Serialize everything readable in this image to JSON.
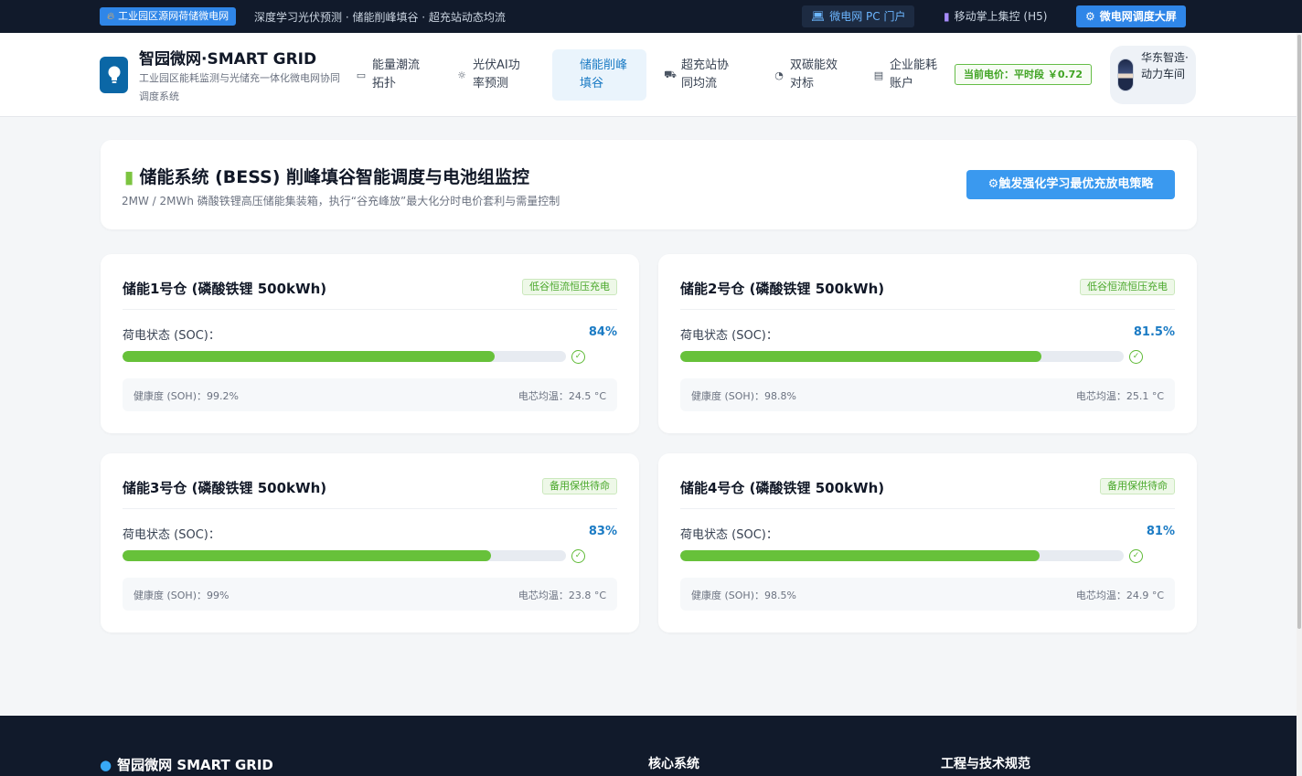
{
  "topbar": {
    "badge": "工业园区源网荷储微电网",
    "tagline": "深度学习光伏预测 · 储能削峰填谷 · 超充站动态均流",
    "links": {
      "pc_portal": "微电网 PC 门户",
      "mobile": "移动掌上集控 (H5)",
      "big_screen": "微电网调度大屏"
    }
  },
  "header": {
    "brand_title": "智园微网·SMART GRID",
    "brand_subtitle": "工业园区能耗监测与光储充一体化微电网协同调度系统",
    "nav": [
      {
        "label": "能量潮流拓扑",
        "icon": "monitor-icon",
        "active": false
      },
      {
        "label": "光伏AI功率预测",
        "icon": "sun-icon",
        "active": false
      },
      {
        "label": "储能削峰填谷",
        "icon": "battery-icon",
        "active": true
      },
      {
        "label": "超充站协同均流",
        "icon": "truck-icon",
        "active": false
      },
      {
        "label": "双碳能效对标",
        "icon": "pie-chart-icon",
        "active": false
      },
      {
        "label": "企业能耗账户",
        "icon": "building-icon",
        "active": false
      }
    ],
    "price_badge": "当前电价：平时段 ￥0.72",
    "user_name": "华东智造·动力车间"
  },
  "intro": {
    "title": "储能系统 (BESS) 削峰填谷智能调度与电池组监控",
    "subtitle": "2MW / 2MWh 磷酸铁锂高压储能集装箱，执行“谷充峰放”最大化分时电价套利与需量控制",
    "button": "触发强化学习最优充放电策略"
  },
  "soc_label": "荷电状态 (SOC)：",
  "units": [
    {
      "title": "储能1号仓 (磷酸铁锂 500kWh)",
      "mode": "低谷恒流恒压充电",
      "soc_text": "84%",
      "soc": 84,
      "soh": "健康度 (SOH)：99.2%",
      "temp": "电芯均温：24.5 °C"
    },
    {
      "title": "储能2号仓 (磷酸铁锂 500kWh)",
      "mode": "低谷恒流恒压充电",
      "soc_text": "81.5%",
      "soc": 81.5,
      "soh": "健康度 (SOH)：98.8%",
      "temp": "电芯均温：25.1 °C"
    },
    {
      "title": "储能3号仓 (磷酸铁锂 500kWh)",
      "mode": "备用保供待命",
      "soc_text": "83%",
      "soc": 83,
      "soh": "健康度 (SOH)：99%",
      "temp": "电芯均温：23.8 °C"
    },
    {
      "title": "储能4号仓 (磷酸铁锂 500kWh)",
      "mode": "备用保供待命",
      "soc_text": "81%",
      "soc": 81,
      "soh": "健康度 (SOH)：98.5%",
      "temp": "电芯均温：24.9 °C"
    }
  ],
  "footer": {
    "brand": "智园微网 SMART GRID",
    "col1": "核心系统",
    "col2": "工程与技术规范"
  },
  "colors": {
    "accent": "#2f86e8",
    "soc_fill": "#67c13a",
    "soc_text": "#1b7bc4",
    "price": "#3fa322"
  }
}
